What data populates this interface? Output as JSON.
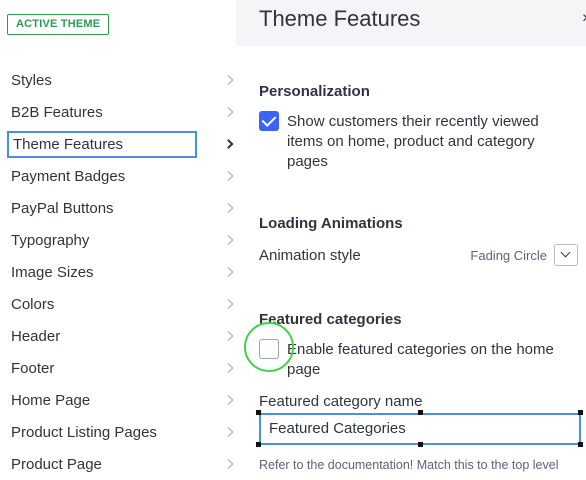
{
  "sidebar": {
    "badge": "ACTIVE THEME",
    "items": [
      {
        "label": "Styles"
      },
      {
        "label": "B2B Features"
      },
      {
        "label": "Theme Features"
      },
      {
        "label": "Payment Badges"
      },
      {
        "label": "PayPal Buttons"
      },
      {
        "label": "Typography"
      },
      {
        "label": "Image Sizes"
      },
      {
        "label": "Colors"
      },
      {
        "label": "Header"
      },
      {
        "label": "Footer"
      },
      {
        "label": "Home Page"
      },
      {
        "label": "Product Listing Pages"
      },
      {
        "label": "Product Page"
      }
    ],
    "active_item": "Theme Features"
  },
  "panel": {
    "title": "Theme Features",
    "close_icon": "close-icon",
    "personalization": {
      "title": "Personalization",
      "checkbox_label": "Show customers their recently viewed items on home, product and category pages",
      "checked": true
    },
    "loading_animations": {
      "title": "Loading Animations",
      "field_label": "Animation style",
      "selected_value": "Fading Circle"
    },
    "featured_categories": {
      "title": "Featured categories",
      "checkbox_label": "Enable featured categories on the home page",
      "checked": false,
      "name_label": "Featured category name",
      "name_value": "Featured Categories",
      "help_text": "Refer to the documentation! Match this to the top level"
    }
  },
  "colors": {
    "accent": "#3c64f4",
    "focus": "#4a90e2",
    "badge_green": "#2f9a4f",
    "click_ring": "#42d24a"
  }
}
